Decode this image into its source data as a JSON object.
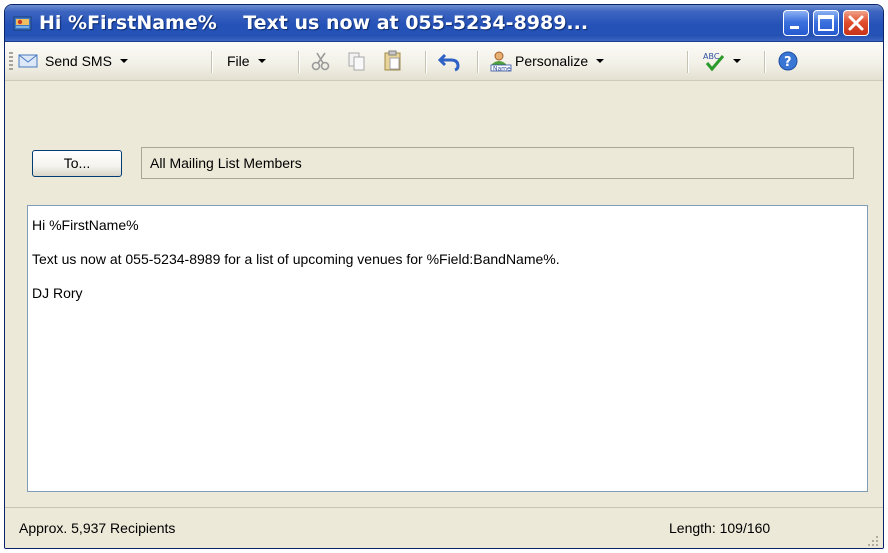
{
  "window": {
    "title": "Hi %FirstName%    Text us now at 055-5234-8989...",
    "accent_color": "#2552b8",
    "close_color": "#e24f2d"
  },
  "toolbar": {
    "send_sms_label": "Send SMS",
    "file_label": "File",
    "personalize_label": "Personalize",
    "icons": [
      "send-sms-icon",
      "cut-icon",
      "copy-icon",
      "paste-icon",
      "undo-icon",
      "personalize-icon",
      "spellcheck-icon",
      "help-icon"
    ]
  },
  "recipients": {
    "to_button_label": "To...",
    "to_value": "All Mailing List Members"
  },
  "message": {
    "lines": [
      "Hi %FirstName%",
      "Text us now at 055-5234-8989 for a list of upcoming venues for %Field:BandName%.",
      "DJ Rory"
    ]
  },
  "status": {
    "recipients_text": "Approx. 5,937 Recipients",
    "length_text": "Length: 109/160"
  }
}
